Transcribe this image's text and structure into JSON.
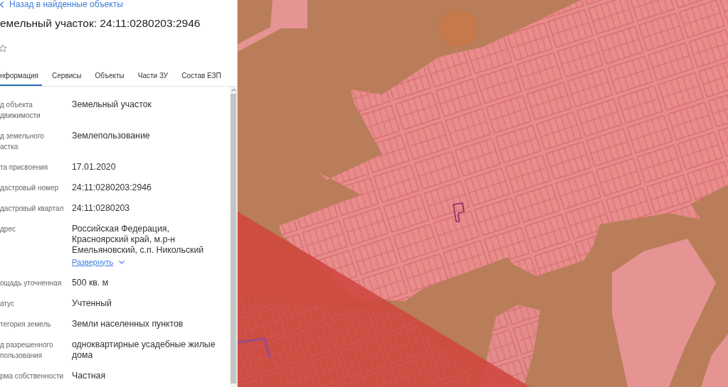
{
  "back_link": {
    "label": "Назад в найденные объекты"
  },
  "title": "емельный участок: 24:11:0280203:2946",
  "tabs": [
    {
      "label": "нформация",
      "selected": true
    },
    {
      "label": "Сервисы",
      "selected": false
    },
    {
      "label": "Объекты",
      "selected": false
    },
    {
      "label": "Части ЗУ",
      "selected": false
    },
    {
      "label": "Состав ЕЗП",
      "selected": false
    }
  ],
  "properties": [
    {
      "label": "д объекта\nдвижимости",
      "value": "Земельный участок"
    },
    {
      "label": "д земельного\nастка",
      "value": "Землепользование"
    },
    {
      "label": "та присвоения",
      "value": "17.01.2020"
    },
    {
      "label": "дастровый номер",
      "value": "24:11:0280203:2946"
    },
    {
      "label": "дастровый квартал",
      "value": "24:11:0280203"
    },
    {
      "label": "дрес",
      "value": "Российская Федерация,\nКрасноярский край, м.р-н\nЕмельяновский, с.п. Никольский",
      "link": "Развернуть"
    },
    {
      "label": "ощадь уточненная",
      "value": "500 кв. м"
    },
    {
      "label": "атус",
      "value": "Учтенный"
    },
    {
      "label": "тегория земель",
      "value": "Земли населенных пунктов"
    },
    {
      "label": "д разрешенного\nпользования",
      "value": "одноквартирные усадебные жилые\nдома"
    },
    {
      "label": "рма собственности",
      "value": "Частная"
    }
  ]
}
